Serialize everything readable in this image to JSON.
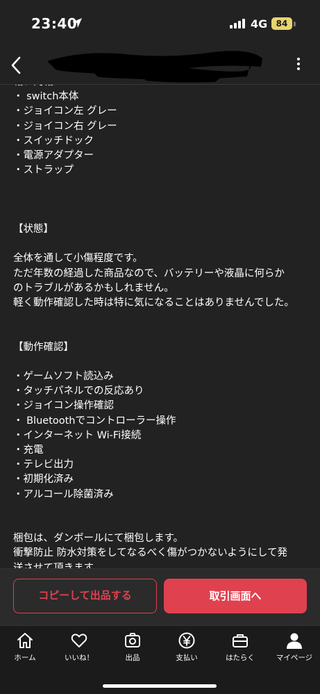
{
  "status_bar": {
    "time": "23:40",
    "network": "4G",
    "battery": "84"
  },
  "nav": {
    "back_icon": "chevron-left-icon",
    "more_icon": "more-vertical-icon"
  },
  "description": {
    "lines": [
      "箱、内箱",
      "・ switch本体",
      "・ジョイコン左 グレー",
      "・ジョイコン右 グレー",
      "・スイッチドック",
      "・電源アダプター",
      "・ストラップ",
      "",
      "",
      "",
      "【状態】",
      "",
      "全体を通して小傷程度です。",
      "ただ年数の経過した商品なので、バッテリーや液晶に何らか",
      "のトラブルがあるかもしれません。",
      "軽く動作確認した時は特に気になることはありませんでした。",
      "",
      "",
      "【動作確認】",
      "",
      "・ゲームソフト読込み",
      "・タッチパネルでの反応あり",
      "・ジョイコン操作確認",
      "・ Bluetoothでコントローラー操作",
      "・インターネット Wi-Fi接続",
      "・充電",
      "・テレビ出力",
      "・初期化済み",
      "・アルコール除菌済み",
      "",
      "",
      "梱包は、ダンボールにて梱包します。",
      "衝撃防止 防水対策をしてなるべく傷がつかないようにして発",
      "送させて頂きます。"
    ]
  },
  "actions": {
    "copy_label": "コピーして出品する",
    "trade_label": "取引画面へ"
  },
  "tabs": [
    {
      "label": "ホーム",
      "icon": "home-icon"
    },
    {
      "label": "いいね！",
      "icon": "heart-icon"
    },
    {
      "label": "出品",
      "icon": "camera-icon"
    },
    {
      "label": "支払い",
      "icon": "yen-icon"
    },
    {
      "label": "はたらく",
      "icon": "briefcase-icon"
    },
    {
      "label": "マイページ",
      "icon": "user-icon"
    }
  ],
  "colors": {
    "accent": "#e0414f",
    "background": "#222222",
    "tab_bar": "#1b1b1b"
  }
}
